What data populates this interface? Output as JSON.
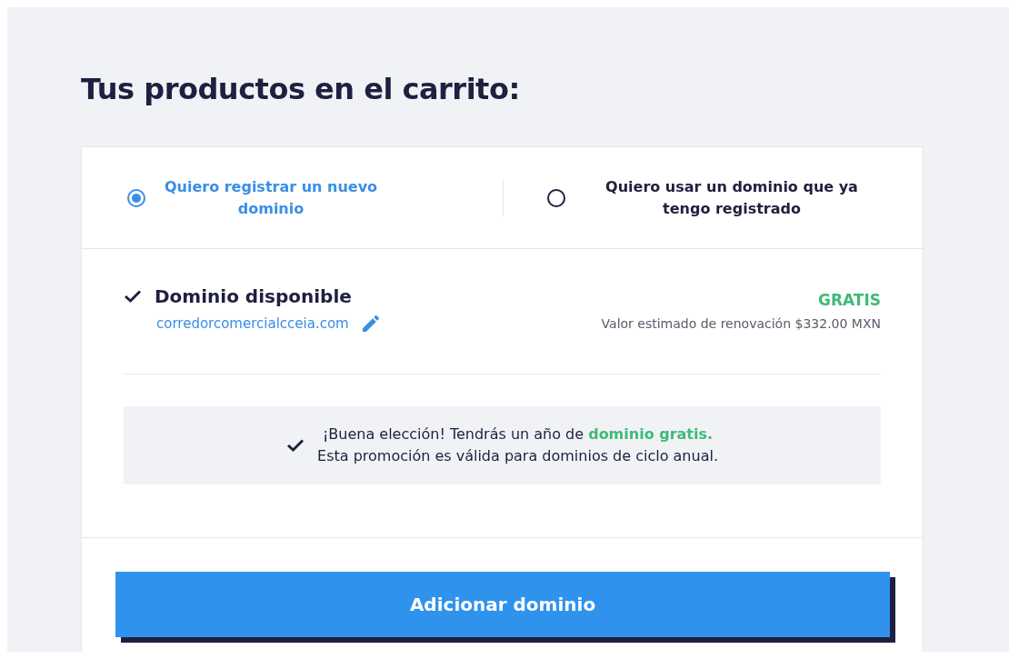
{
  "title": "Tus productos en el carrito:",
  "options": [
    {
      "label": "Quiero registrar un nuevo dominio",
      "selected": true
    },
    {
      "label": "Quiero usar un dominio que ya tengo registrado",
      "selected": false
    }
  ],
  "domain": {
    "status": "Dominio disponible",
    "name": "corredorcomercialcceia.com",
    "price": "GRATIS",
    "renewal": "Valor estimado de renovación $332.00 MXN"
  },
  "promo": {
    "lines": [
      "¡Buena elección! Tendrás un año de **dominio gratis.**",
      "Esta promoción es válida para dominios de ciclo anual."
    ]
  },
  "button": "Adicionar dominio"
}
